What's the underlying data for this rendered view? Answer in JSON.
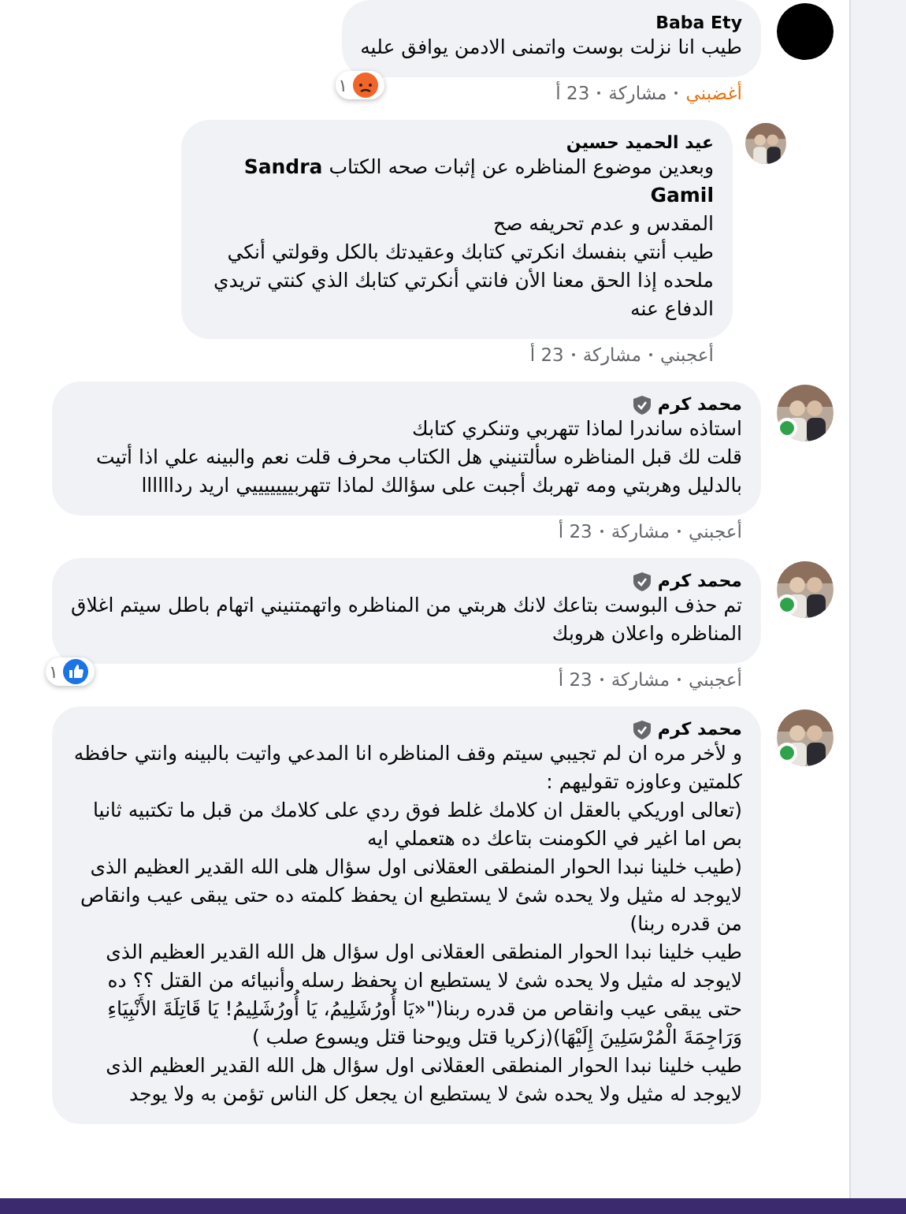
{
  "comments": [
    {
      "author": "Baba Ety",
      "verified": false,
      "online": false,
      "reply": false,
      "avatar": {
        "kind": "plain"
      },
      "paragraphs": [
        "طيب انا نزلت بوست واتمنى الادمن يوافق عليه"
      ],
      "reaction": {
        "kind": "angry",
        "count": "١"
      },
      "like_label": "أغضبني",
      "reacted": true,
      "share_label": "مشاركة",
      "time": "23 أ"
    },
    {
      "author": "عيد الحميد حسين",
      "verified": false,
      "online": false,
      "reply": true,
      "avatar": {
        "kind": "photo"
      },
      "paragraphs": [
        "وبعدين موضوع المناظره عن إثبات صحه الكتاب **Sandra Gamil**",
        "المقدس و عدم تحريفه صح",
        "طيب أنتي بنفسك انكرتي كتابك وعقيدتك بالكل وقولتي أنكي ملحده إذا الحق معنا الأن فانتي أنكرتي كتابك الذي كنتي تريدي الدفاع عنه"
      ],
      "like_label": "أعجبني",
      "reacted": false,
      "share_label": "مشاركة",
      "time": "23 أ"
    },
    {
      "author": "محمد كرم",
      "verified": true,
      "online": true,
      "reply": false,
      "avatar": {
        "kind": "photo"
      },
      "paragraphs": [
        "استاذه ساندرا لماذا تتهربي وتنكري كتابك",
        "قلت لك قبل المناظره سألتنيني هل الكتاب محرف قلت نعم والبينه علي اذا أتيت بالدليل وهربتي ومه تهربك أجبت على سؤالك لماذا تتهربيييييييي اريد رداااااا"
      ],
      "like_label": "أعجبني",
      "reacted": false,
      "share_label": "مشاركة",
      "time": "23 أ"
    },
    {
      "author": "محمد كرم",
      "verified": true,
      "online": true,
      "reply": false,
      "avatar": {
        "kind": "photo"
      },
      "paragraphs": [
        "تم حذف البوست بتاعك لانك هربتي من المناظره واتهمتنيني اتهام باطل سيتم اغلاق المناظره واعلان هروبك"
      ],
      "reaction": {
        "kind": "like",
        "count": "١"
      },
      "like_label": "أعجبني",
      "reacted": false,
      "share_label": "مشاركة",
      "time": "23 أ"
    },
    {
      "author": "محمد كرم",
      "verified": true,
      "online": true,
      "reply": false,
      "avatar": {
        "kind": "photo"
      },
      "paragraphs": [
        "و لأخر مره ان لم تجيبي سيتم وقف المناظره انا المدعي واتيت بالبينه وانتي حافظه كلمتين وعاوزه تقوليهم :",
        "(تعالى اوريكي بالعقل ان كلامك غلط فوق ردي على كلامك من قبل ما تكتبيه ثانيا بص اما اغير في الكومنت بتاعك ده هتعملي ايه",
        "(طيب خلينا نبدا الحوار المنطقى العقلانى اول سؤال هلى الله القدير العظيم الذى لايوجد له مثيل ولا يحده شئ لا يستطيع ان يحفظ كلمته ده حتى يبقى عيب وانقاص من قدره ربنا)",
        "طيب خلينا نبدا الحوار المنطقى العقلانى اول سؤال هل الله القدير العظيم الذى لايوجد له مثيل ولا يحده شئ لا يستطيع ان يحفظ رسله وأنبيائه من القتل ؟؟ ده حتى يبقى عيب وانقاص من قدره ربنا(\"«يَا أُورُشَلِيمُ، يَا أُورُشَلِيمُ! يَا قَاتِلَةَ الأَنْبِيَاءِ وَرَاجِمَةَ الْمُرْسَلِينَ إِلَيْهَا)(زكريا قتل ويوحنا قتل ويسوع صلب )",
        "طيب خلينا نبدا الحوار المنطقى العقلانى اول سؤال هل الله القدير العظيم الذى لايوجد له مثيل ولا يحده شئ لا يستطيع ان يجعل كل الناس تؤمن به ولا يوجد"
      ]
    }
  ]
}
